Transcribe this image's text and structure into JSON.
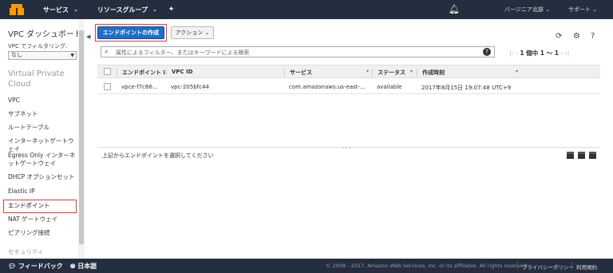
{
  "topbar": {
    "services": "サービス",
    "resource_groups": "リソースグループ",
    "region": "バージニア北部",
    "support": "サポート"
  },
  "sidebar": {
    "dashboard": "VPC ダッシュボード",
    "filter_label": "VPC でフィルタリング:",
    "filter_value": "なし",
    "group_title": "Virtual Private Cloud",
    "items": [
      {
        "label": "VPC"
      },
      {
        "label": "サブネット"
      },
      {
        "label": "ルートテーブル"
      },
      {
        "label": "インターネットゲートウェイ"
      },
      {
        "label": "Egress Only インターネットゲートウェイ"
      },
      {
        "label": "DHCP オプションセット"
      },
      {
        "label": "Elastic IP"
      },
      {
        "label": "エンドポイント"
      },
      {
        "label": "NAT ゲートウェイ"
      },
      {
        "label": "ピアリング接続"
      },
      {
        "label": "セキュリティ"
      }
    ]
  },
  "toolbar": {
    "create_label": "エンドポイントの作成",
    "action_label": "アクション"
  },
  "search": {
    "placeholder": "属性によるフィルター、またはキーワードによる検索"
  },
  "pager": {
    "text": "1 個中 1 ～ 1"
  },
  "table": {
    "columns": [
      "エンドポイント I",
      "VPC ID",
      "サービス",
      "ステータス",
      "作成時刻"
    ],
    "rows": [
      {
        "endpoint": "vpce-f7c66...",
        "vpc": "vpc-205bfc44",
        "service": "com.amazonaws.us-east-...",
        "status": "available",
        "created": "2017年8月15日 19:07:48 UTC+9"
      }
    ]
  },
  "lower_panel": {
    "message": "上記からエンドポイントを選択してください"
  },
  "footer": {
    "feedback": "フィードバック",
    "language": "日本語",
    "copyright": "© 2008 - 2017, Amazon Web Services, Inc. or its affiliates. All rights reserved.",
    "privacy": "プライバシーポリシー",
    "terms": "利用規約"
  },
  "colors": {
    "nav_bg": "#232f3e",
    "primary": "#1f6fc9",
    "highlight": "#e53935"
  }
}
